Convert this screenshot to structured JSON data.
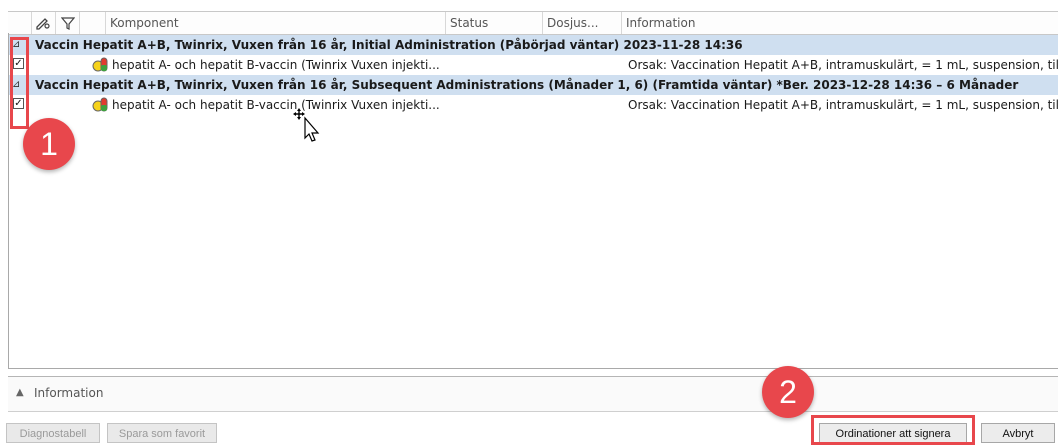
{
  "columns": {
    "icon1": "edit-icon",
    "icon2": "filter-icon",
    "komponent": "Komponent",
    "status": "Status",
    "dosjus": "Dosjus...",
    "information": "Information"
  },
  "groups": [
    {
      "title": "Vaccin Hepatit A+B, Twinrix, Vuxen från 16 år, Initial Administration (Påbörjad väntar) 2023-11-28 14:36",
      "expander": "⊿",
      "item": {
        "checked": true,
        "component": "hepatit A- och hepatit B-vaccin (Twinrix Vuxen injekti...",
        "info": "Orsak: Vaccination Hepatit A+B, intramuskulärt, = 1 mL, suspension, till..."
      }
    },
    {
      "title": "Vaccin Hepatit A+B, Twinrix, Vuxen från 16 år, Subsequent Administrations (Månader 1, 6) (Framtida väntar) *Ber. 2023-12-28 14:36 – 6 Månader",
      "expander": "⊿",
      "item": {
        "checked": true,
        "component": "hepatit A- och hepatit B-vaccin (Twinrix Vuxen injekti...",
        "info": "Orsak: Vaccination Hepatit A+B, intramuskulärt, = 1 mL, suspension, till..."
      }
    }
  ],
  "info_panel": {
    "label": "Information"
  },
  "buttons": {
    "diagnostabell": "Diagnostabell",
    "spara_favorit": "Spara som favorit",
    "ordinationer": "Ordinationer att signera",
    "avbryt": "Avbryt"
  },
  "annotations": {
    "badge1": "1",
    "badge2": "2"
  },
  "colors": {
    "annotation": "#e8474c",
    "group_bg": "#cfdff0"
  }
}
